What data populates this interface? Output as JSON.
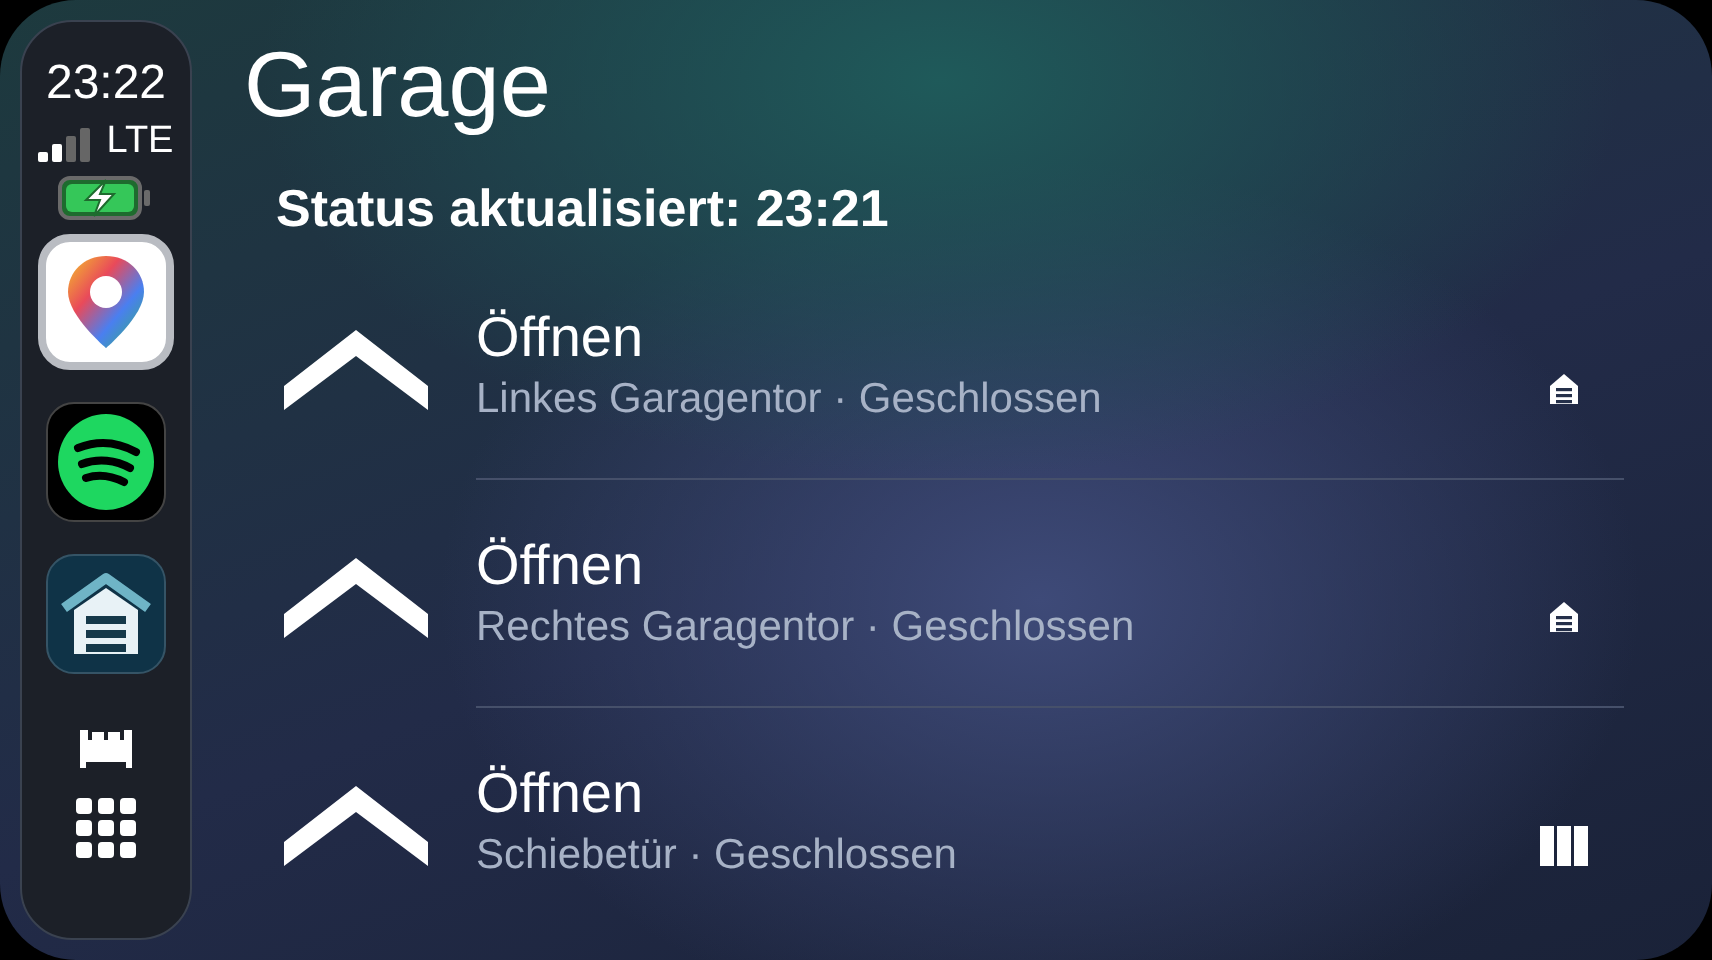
{
  "status_bar": {
    "time": "23:22",
    "network": "LTE"
  },
  "dock": [
    {
      "kind": "maps",
      "focused": true
    },
    {
      "kind": "music",
      "focused": false
    },
    {
      "kind": "garage",
      "focused": false
    },
    {
      "kind": "bed",
      "focused": false
    },
    {
      "kind": "apps",
      "focused": false
    }
  ],
  "title": "Garage",
  "status": "Status aktualisiert: 23:21",
  "doors": [
    {
      "action": "Öffnen",
      "detail": "Linkes Garagentor · Geschlossen",
      "kind": "garage"
    },
    {
      "action": "Öffnen",
      "detail": "Rechtes Garagentor · Geschlossen",
      "kind": "garage"
    },
    {
      "action": "Öffnen",
      "detail": "Schiebetür · Geschlossen",
      "kind": "sliding"
    }
  ]
}
